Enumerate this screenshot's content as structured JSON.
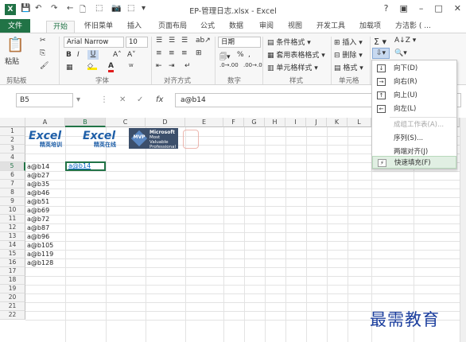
{
  "window": {
    "title": "EP-管理日志.xlsx - Excel",
    "app_icon": "X",
    "controls": [
      "?",
      "▣",
      "–",
      "□",
      "✕"
    ]
  },
  "quick_access": [
    "💾",
    "↶",
    "↷",
    "←",
    "🗋",
    "⬚",
    "📷",
    "⬚",
    "▾"
  ],
  "tabs": [
    "文件",
    "开始",
    "怀旧菜单",
    "插入",
    "页面布局",
    "公式",
    "数据",
    "审阅",
    "视图",
    "开发工具",
    "加载项",
    "方洁影 ( ..."
  ],
  "ribbon": {
    "font_name": "Arial Narrow",
    "font_size": "10",
    "number_format": "日期",
    "paste_label": "粘贴",
    "groups": {
      "clipboard": "剪贴板",
      "font": "字体",
      "alignment": "对齐方式",
      "number": "数字",
      "styles": "样式",
      "cells": "单元格"
    },
    "styles_items": [
      "条件格式 ▾",
      "套用表格格式 ▾",
      "单元格样式 ▾"
    ],
    "cells_items": [
      "插入 ▾",
      "删除 ▾",
      "格式 ▾"
    ]
  },
  "formula_bar": {
    "name_box": "B5",
    "fx": "fx",
    "content": "a@b14"
  },
  "grid": {
    "columns": [
      "A",
      "B",
      "C",
      "D",
      "E",
      "F",
      "G",
      "H",
      "I",
      "J",
      "K",
      "L"
    ],
    "rows": [
      "1",
      "2",
      "3",
      "4",
      "5",
      "6",
      "7",
      "8",
      "9",
      "10",
      "11",
      "12",
      "13",
      "14",
      "15",
      "16",
      "17",
      "18",
      "19",
      "20",
      "21",
      "22"
    ],
    "selected_cell": "a@b14",
    "colA": [
      "a@b14",
      "a@b27",
      "a@b35",
      "a@b46",
      "a@b51",
      "a@b69",
      "a@b72",
      "a@b87",
      "a@b96",
      "a@b105",
      "a@b119",
      "a@b128"
    ]
  },
  "logos": {
    "excel1_line1": "Excel",
    "excel1_line2": "精英培训",
    "excel2_line1": "Excel",
    "excel2_line2": "精英在线",
    "mvp_badge": "MVP",
    "mvp_line1": "Microsoft",
    "mvp_line2": "Most Valuable",
    "mvp_line3": "Professional"
  },
  "fill_menu": {
    "items": [
      {
        "label": "向下(D)",
        "icon": "↓",
        "disabled": false
      },
      {
        "label": "向右(R)",
        "icon": "→",
        "disabled": false
      },
      {
        "label": "向上(U)",
        "icon": "↑",
        "disabled": false
      },
      {
        "label": "向左(L)",
        "icon": "←",
        "disabled": false
      },
      {
        "label": "成组工作表(A)...",
        "icon": "",
        "disabled": true
      },
      {
        "label": "序列(S)...",
        "icon": "",
        "disabled": false
      },
      {
        "label": "两端对齐(J)",
        "icon": "",
        "disabled": false
      },
      {
        "label": "快速填充(F)",
        "icon": "⚡",
        "disabled": false,
        "highlighted": true
      }
    ]
  },
  "watermark": "最需教育"
}
